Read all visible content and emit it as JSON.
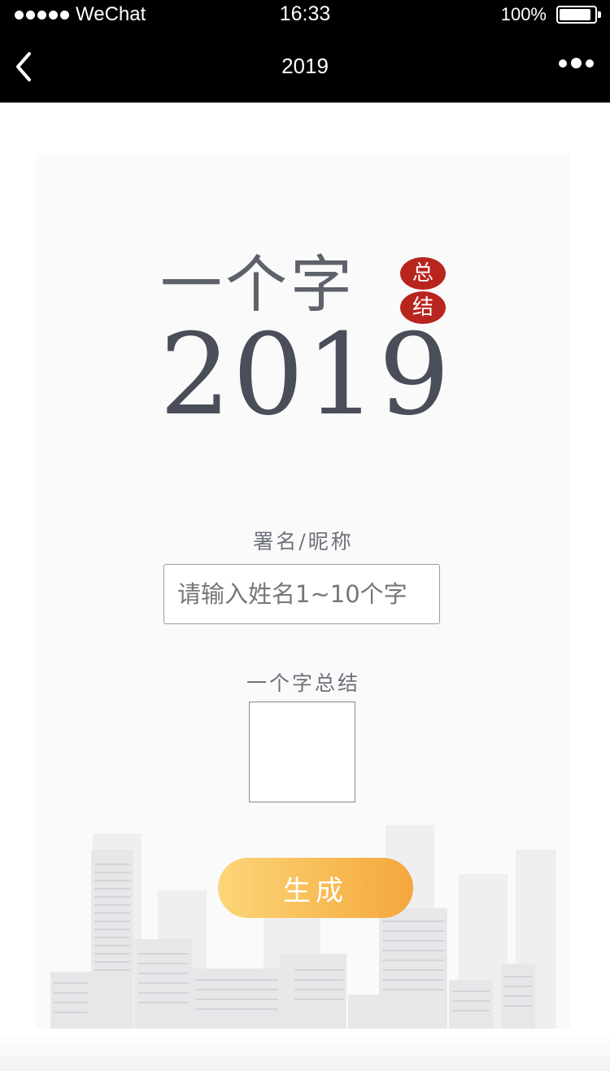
{
  "status_bar": {
    "carrier": "WeChat",
    "time": "16:33",
    "battery": "100%",
    "battery_level": 1.0,
    "signal_bars": 5
  },
  "nav": {
    "title": "2019",
    "back_icon": "chevron-left-icon",
    "more_icon": "more-dots-icon"
  },
  "poster": {
    "title": "一个字",
    "seal_top": "总",
    "seal_bottom": "结",
    "year": "2019"
  },
  "form": {
    "name_label": "署名/昵称",
    "name_placeholder": "请输入姓名1~10个字",
    "name_value": "",
    "word_label": "一个字总结",
    "word_value": "",
    "submit_label": "生成"
  },
  "colors": {
    "accent_start": "#fcd57a",
    "accent_end": "#f4a73c",
    "seal": "#b8251e",
    "title": "#4a4e58"
  }
}
